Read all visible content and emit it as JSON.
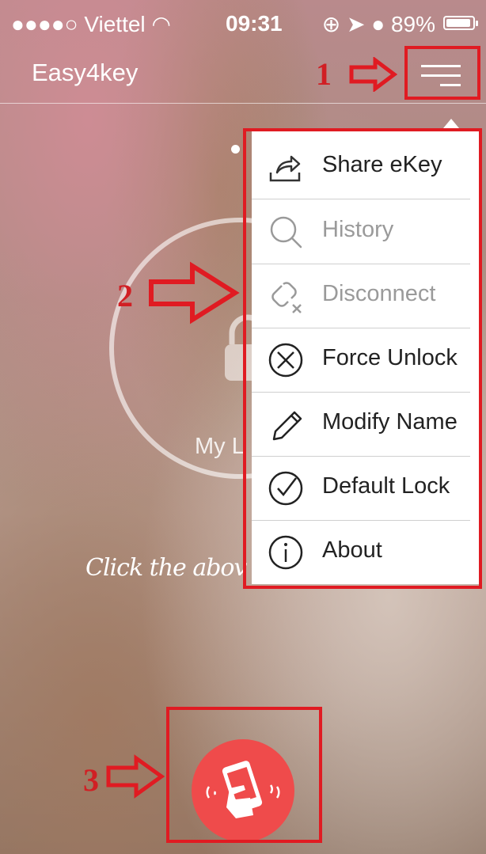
{
  "status_bar": {
    "carrier": "●●●●○ Viettel",
    "time": "09:31",
    "battery": "89%"
  },
  "nav": {
    "title": "Easy4key"
  },
  "background": {
    "lock_name_partial": "My L",
    "hint_partial": "Click the abov"
  },
  "menu": {
    "items": [
      {
        "label": "Share eKey",
        "icon": "share-icon",
        "enabled": true
      },
      {
        "label": "History",
        "icon": "search-icon",
        "enabled": false
      },
      {
        "label": "Disconnect",
        "icon": "disconnect-icon",
        "enabled": false
      },
      {
        "label": "Force Unlock",
        "icon": "force-unlock-icon",
        "enabled": true
      },
      {
        "label": "Modify Name",
        "icon": "pencil-icon",
        "enabled": true
      },
      {
        "label": "Default Lock",
        "icon": "check-circle-icon",
        "enabled": true
      },
      {
        "label": "About",
        "icon": "info-icon",
        "enabled": true
      }
    ]
  },
  "annotations": {
    "one": "1",
    "two": "2",
    "three": "3"
  },
  "colors": {
    "annotation_red": "#e01b22",
    "action_button": "#ef4b4b"
  }
}
